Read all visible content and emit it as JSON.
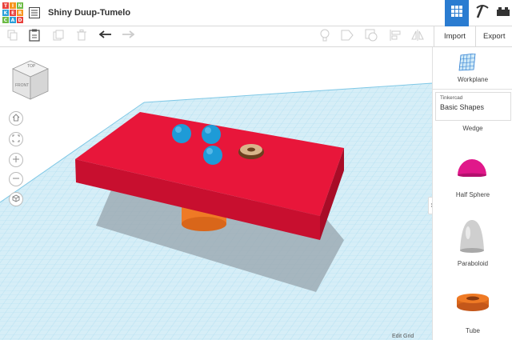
{
  "app": {
    "logo_letters": [
      "T",
      "I",
      "N",
      "K",
      "E",
      "R",
      "C",
      "A",
      "D"
    ],
    "logo_colors": [
      "#e8413c",
      "#f7941d",
      "#6dbb45",
      "#2a9fd8",
      "#e8413c",
      "#f7941d",
      "#6dbb45",
      "#2a9fd8",
      "#e8413c"
    ],
    "title": "Shiny Duup-Tumelo",
    "accent": "#2a7cd1"
  },
  "toolbar": {
    "import_label": "Import",
    "export_label": "Export"
  },
  "viewcube": {
    "top_label": "TOP",
    "front_label": "FRONT"
  },
  "canvas": {
    "edit_grid_label": "Edit Grid",
    "colors": {
      "box": "#e8163a",
      "spheres": "#1e9bd7",
      "cylinder": "#ef7a25",
      "grid": "#a9dcef"
    }
  },
  "sidebar": {
    "workplane_label": "Workplane",
    "library_source": "Tinkercad",
    "library_name": "Basic Shapes",
    "shapes": [
      {
        "label": "Wedge",
        "color": "#888888"
      },
      {
        "label": "Half Sphere",
        "color": "#e0188a"
      },
      {
        "label": "Paraboloid",
        "color": "#c8c8c8"
      },
      {
        "label": "Tube",
        "color": "#ef7a25"
      }
    ]
  }
}
